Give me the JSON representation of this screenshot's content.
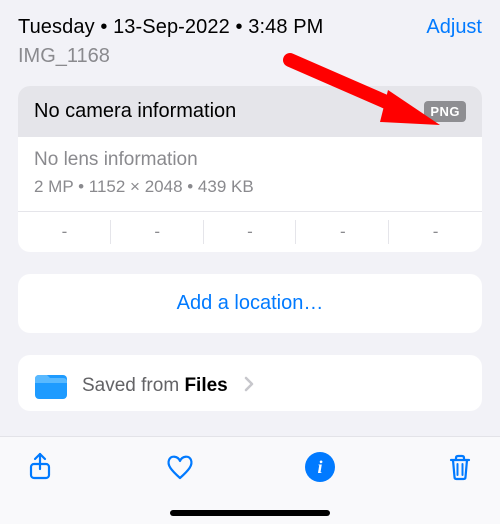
{
  "header": {
    "date_line": "Tuesday • 13-Sep-2022 • 3:48 PM",
    "adjust_label": "Adjust",
    "image_name": "IMG_1168"
  },
  "camera": {
    "text": "No camera information",
    "format_badge": "PNG"
  },
  "lens": {
    "text": "No lens information",
    "meta": "2 MP  •  1152 × 2048  •  439 KB",
    "focal": [
      "-",
      "-",
      "-",
      "-",
      "-"
    ]
  },
  "location": {
    "add_label": "Add a location…"
  },
  "source": {
    "prefix": "Saved from ",
    "app": "Files"
  },
  "toolbar": {
    "share": "share",
    "favorite": "favorite",
    "info": "info",
    "delete": "delete"
  }
}
